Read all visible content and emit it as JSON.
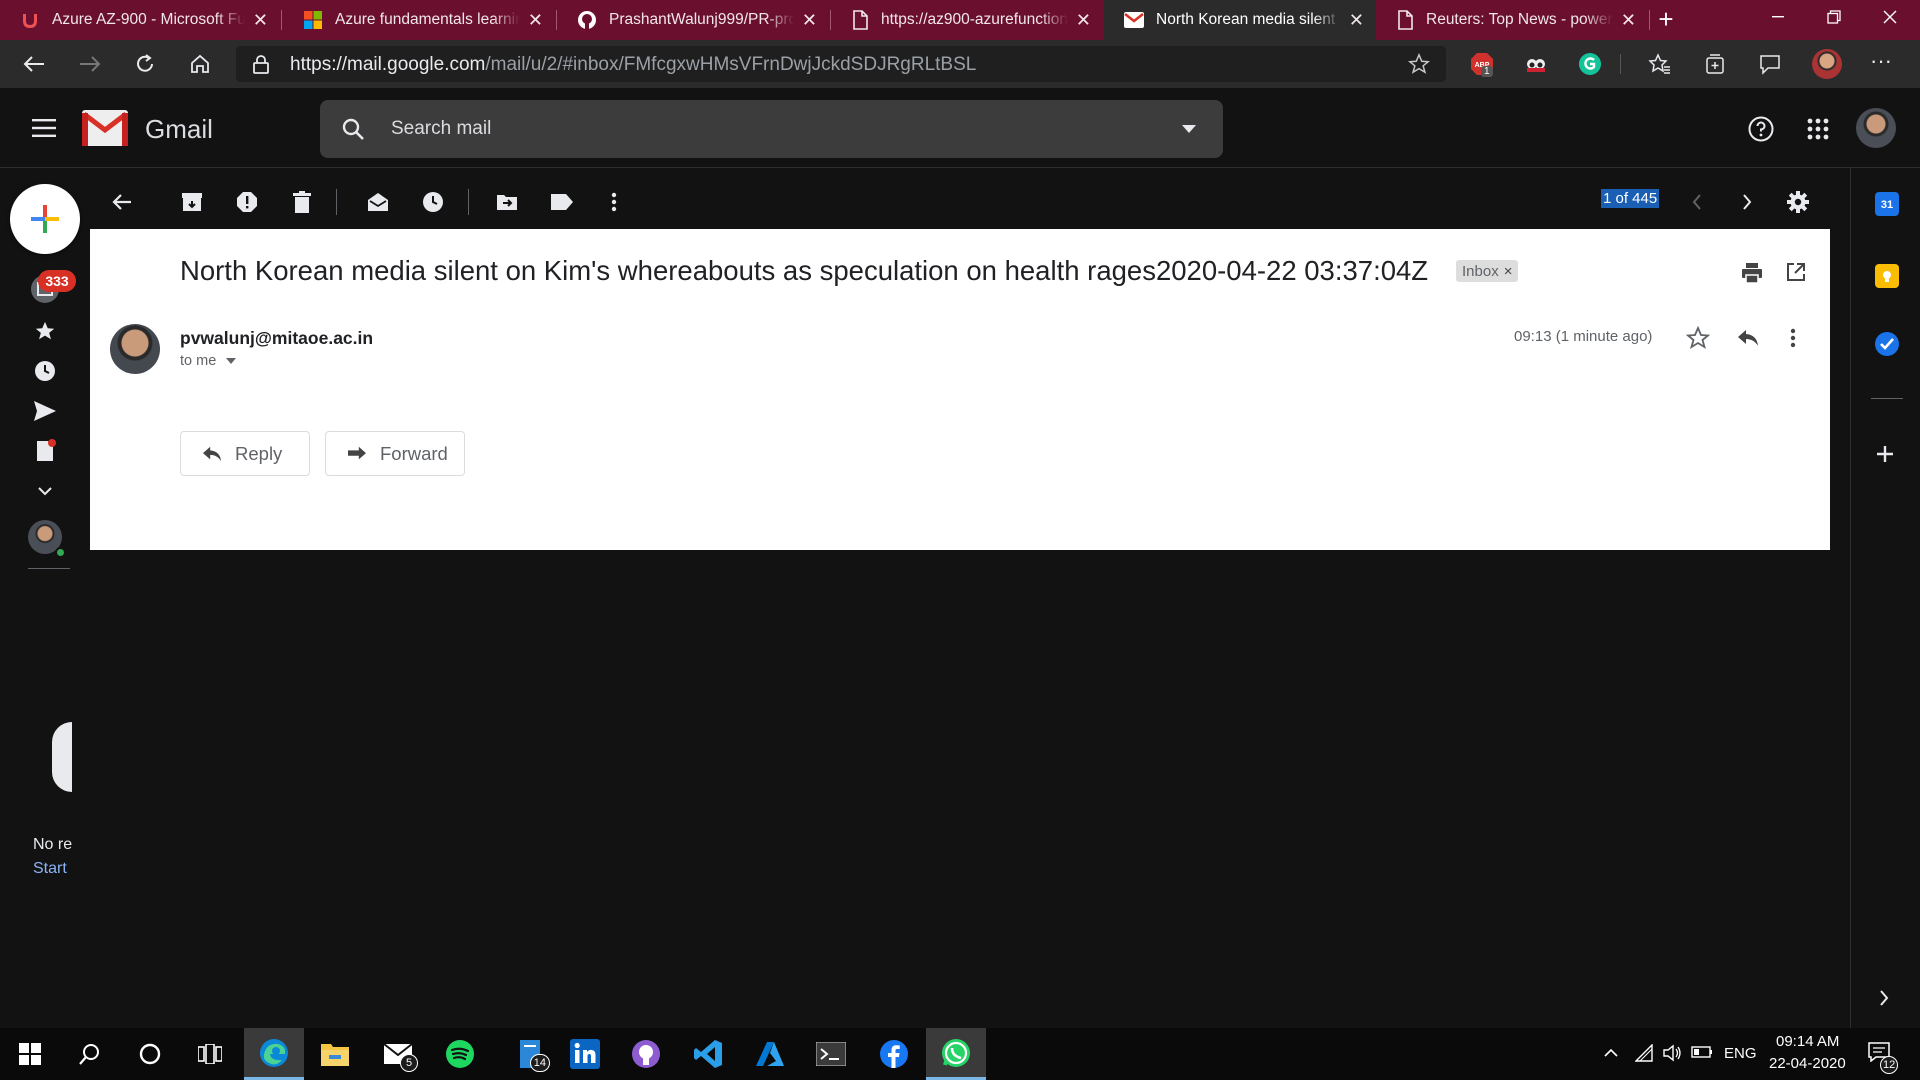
{
  "browser": {
    "tabs": [
      {
        "title": "Azure AZ-900 - Microsoft Fu",
        "icon": "udemy-icon",
        "active": false
      },
      {
        "title": "Azure fundamentals learning",
        "icon": "microsoft-icon",
        "active": false
      },
      {
        "title": "PrashantWalunj999/PR-proje",
        "icon": "github-icon",
        "active": false
      },
      {
        "title": "https://az900-azurefunctiona",
        "icon": "page-icon",
        "active": false
      },
      {
        "title": "North Korean media silent o",
        "icon": "gmail-icon",
        "active": true
      },
      {
        "title": "Reuters: Top News - powere",
        "icon": "page-icon",
        "active": false
      }
    ],
    "new_tab": "+",
    "url_host": "https://mail.google.com",
    "url_path": "/mail/u/2/#inbox/FMfcgxwHMsVFrnDwjJckdSDJRgRLtBSL",
    "extension_badge": "1",
    "more": "···"
  },
  "gmail": {
    "product_name": "Gmail",
    "search_placeholder": "Search mail",
    "inbox_count": "333",
    "pager": "1 of 445",
    "accent": "#1a73e8"
  },
  "message": {
    "subject": "North Korean media silent on Kim's whereabouts as speculation on health rages2020-04-22 03:37:04Z",
    "label_chip": "Inbox",
    "label_chip_close": "×",
    "sender": "pvwalunj@mitaoe.ac.in",
    "to": "to me",
    "time": "09:13 (1 minute ago)",
    "reply_label": "Reply",
    "forward_label": "Forward"
  },
  "sidebar_fragment": {
    "line1": "No re",
    "line2": "Start"
  },
  "taskbar": {
    "mail_badge": "5",
    "files_badge": "14",
    "language": "ENG",
    "time": "09:14 AM",
    "date": "22-04-2020",
    "notifications_badge": "12"
  }
}
